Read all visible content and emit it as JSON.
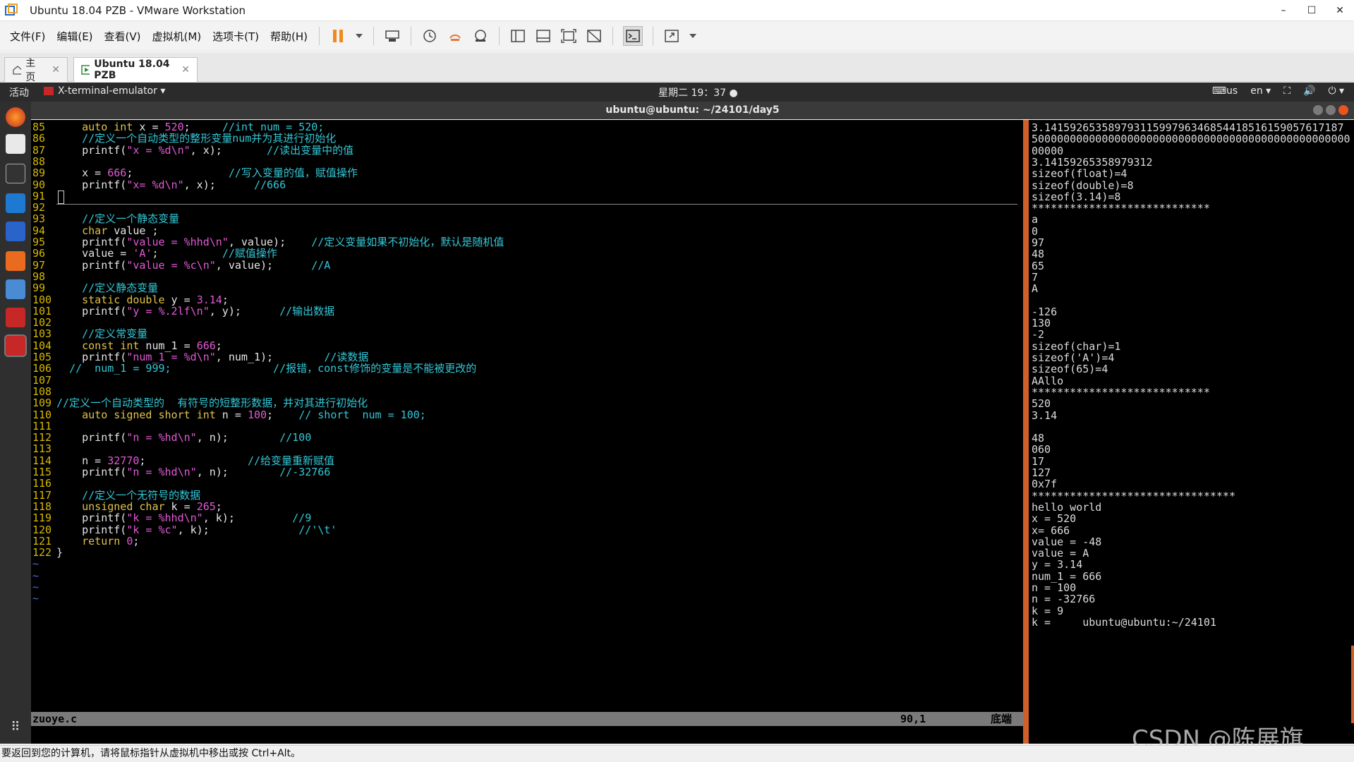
{
  "window": {
    "title": "Ubuntu 18.04 PZB - VMware Workstation",
    "controls": [
      "–",
      "☐",
      "✕"
    ]
  },
  "menubar": {
    "items": [
      "文件(F)",
      "编辑(E)",
      "查看(V)",
      "虚拟机(M)",
      "选项卡(T)",
      "帮助(H)"
    ]
  },
  "tabs": [
    {
      "label": "主页"
    },
    {
      "label": "Ubuntu 18.04 PZB"
    }
  ],
  "gnome": {
    "activities": "活动",
    "app": "X-terminal-emulator ▾",
    "clock": "星期二 19：37",
    "kbd": "us",
    "lang": "en ▾"
  },
  "terminal": {
    "title": "ubuntu@ubuntu: ~/24101/day5"
  },
  "vim": {
    "lines": [
      {
        "n": "85",
        "t": "    auto int x = 520;     //int num = 520;"
      },
      {
        "n": "86",
        "t": "    //定义一个自动类型的整形变量num并为其进行初始化"
      },
      {
        "n": "87",
        "t": "    printf(\"x = %d\\n\", x);       //读出变量中的值"
      },
      {
        "n": "88",
        "t": ""
      },
      {
        "n": "89",
        "t": "    x = 666;               //写入变量的值，赋值操作"
      },
      {
        "n": "90",
        "t": "    printf(\"x= %d\\n\", x);      //666"
      },
      {
        "n": "91",
        "t": ""
      },
      {
        "n": "92",
        "t": ""
      },
      {
        "n": "93",
        "t": "    //定义一个静态变量"
      },
      {
        "n": "94",
        "t": "    char value ;"
      },
      {
        "n": "95",
        "t": "    printf(\"value = %hhd\\n\", value);    //定义变量如果不初始化，默认是随机值"
      },
      {
        "n": "96",
        "t": "    value = 'A';          //赋值操作"
      },
      {
        "n": "97",
        "t": "    printf(\"value = %c\\n\", value);      //A"
      },
      {
        "n": "98",
        "t": ""
      },
      {
        "n": "99",
        "t": "    //定义静态变量"
      },
      {
        "n": "100",
        "t": "    static double y = 3.14;"
      },
      {
        "n": "101",
        "t": "    printf(\"y = %.2lf\\n\", y);      //输出数据"
      },
      {
        "n": "102",
        "t": ""
      },
      {
        "n": "103",
        "t": "    //定义常变量"
      },
      {
        "n": "104",
        "t": "    const int num_1 = 666;"
      },
      {
        "n": "105",
        "t": "    printf(\"num_1 = %d\\n\", num_1);        //读数据"
      },
      {
        "n": "106",
        "t": "  //  num_1 = 999;                //报错，const修饰的变量是不能被更改的"
      },
      {
        "n": "107",
        "t": ""
      },
      {
        "n": "108",
        "t": ""
      },
      {
        "n": "109",
        "t": "//定义一个自动类型的  有符号的短整形数据，并对其进行初始化"
      },
      {
        "n": "110",
        "t": "    auto signed short int n = 100;    // short  num = 100;"
      },
      {
        "n": "111",
        "t": ""
      },
      {
        "n": "112",
        "t": "    printf(\"n = %hd\\n\", n);        //100"
      },
      {
        "n": "113",
        "t": ""
      },
      {
        "n": "114",
        "t": "    n = 32770;                //给变量重新赋值"
      },
      {
        "n": "115",
        "t": "    printf(\"n = %hd\\n\", n);        //-32766"
      },
      {
        "n": "116",
        "t": ""
      },
      {
        "n": "117",
        "t": "    //定义一个无符号的数据"
      },
      {
        "n": "118",
        "t": "    unsigned char k = 265;"
      },
      {
        "n": "119",
        "t": "    printf(\"k = %hhd\\n\", k);         //9"
      },
      {
        "n": "120",
        "t": "    printf(\"k = %c\", k);              //'\\t'"
      },
      {
        "n": "121",
        "t": "    return 0;"
      },
      {
        "n": "122",
        "t": "}"
      }
    ],
    "tildes": [
      "~",
      "~",
      "~",
      "~"
    ],
    "status": {
      "file": "zuoye.c",
      "pos": "90,1",
      "where": "底端"
    }
  },
  "output": {
    "lines": [
      "3.14159265358979311599796346854418516159057617187",
      "50000000000000000000000000000000000000000000000000",
      "00000",
      "3.14159265358979312",
      "sizeof(float)=4",
      "sizeof(double)=8",
      "sizeof(3.14)=8",
      "****************************",
      "a",
      "0",
      "97",
      "48",
      "65",
      "7",
      "A",
      "",
      "-126",
      "130",
      "-2",
      "sizeof(char)=1",
      "sizeof('A')=4",
      "sizeof(65)=4",
      "AAllo",
      "****************************",
      "520",
      "3.14",
      "",
      "48",
      "060",
      "17",
      "127",
      "0x7f",
      "********************************",
      "hello world",
      "x = 520",
      "x= 666",
      "value = -48",
      "value = A",
      "y = 3.14",
      "num_1 = 666",
      "n = 100",
      "n = -32766",
      "k = 9",
      "k =     ubuntu@ubuntu:~/24101"
    ]
  },
  "watermark": "CSDN @陈展旗",
  "statusbar": {
    "text": "要返回到您的计算机，请将鼠标指针从虚拟机中移出或按 Ctrl+Alt。"
  },
  "colors": {
    "linenum": "#d7b900",
    "comment": "#33c7d6",
    "string": "#e35ad6",
    "keyword": "#e0c34a",
    "number": "#e35ad6",
    "split": "#d0602a"
  }
}
